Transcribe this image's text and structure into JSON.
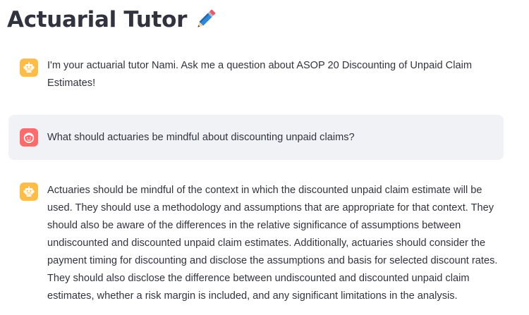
{
  "app": {
    "title": "Actuarial Tutor",
    "title_icon": "pencil-icon"
  },
  "messages": [
    {
      "role": "assistant",
      "avatar_icon": "robot-icon",
      "text": "I'm your actuarial tutor Nami. Ask me a question about ASOP 20 Discounting of Unpaid Claim Estimates!"
    },
    {
      "role": "user",
      "avatar_icon": "user-face-icon",
      "text": "What should actuaries be mindful about discounting unpaid claims?"
    },
    {
      "role": "assistant",
      "avatar_icon": "robot-icon",
      "text": "Actuaries should be mindful of the context in which the discounted unpaid claim estimate will be used. They should use a methodology and assumptions that are appropriate for that context. They should also be aware of the differences in the relative significance of assumptions between undiscounted and discounted unpaid claim estimates. Additionally, actuaries should consider the payment timing for discounting and disclose the assumptions and basis for selected discount rates. They should also disclose the difference between undiscounted and discounted unpaid claim estimates, whether a risk margin is included, and any significant limitations in the analysis."
    }
  ],
  "colors": {
    "assistant_avatar": "#ffbd45",
    "user_avatar": "#ff6b6b",
    "user_bubble": "#f0f2f6",
    "text": "#31333f"
  }
}
